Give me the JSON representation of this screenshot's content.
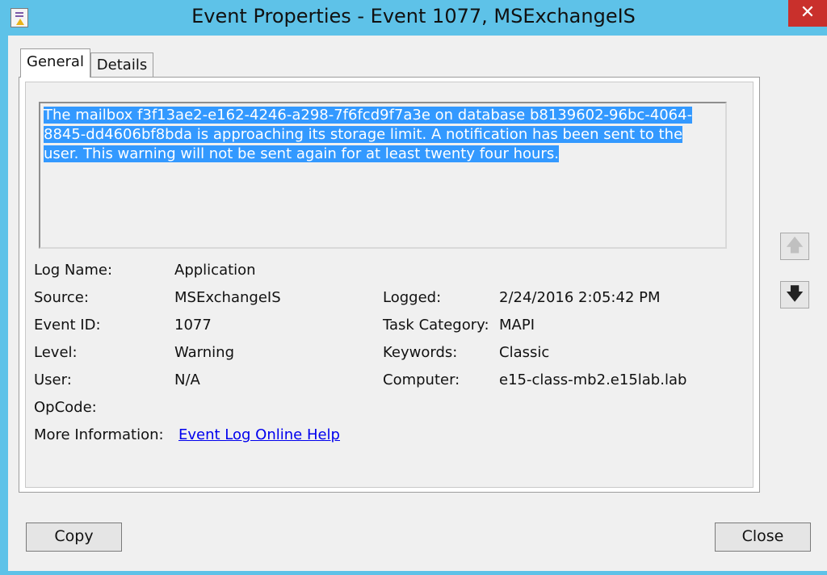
{
  "window": {
    "title": "Event Properties - Event 1077, MSExchangeIS",
    "close_glyph": "✕"
  },
  "tabs": [
    {
      "label": "General"
    },
    {
      "label": "Details"
    }
  ],
  "description": "The mailbox f3f13ae2-e162-4246-a298-7f6fcd9f7a3e on database b8139602-96bc-4064-8845-dd4606bf8bda is approaching its storage limit. A notification has been sent to the user. This warning will not be sent again for at least twenty four hours.",
  "fields": {
    "log_name": {
      "label": "Log Name:",
      "value": "Application"
    },
    "source": {
      "label": "Source:",
      "value": "MSExchangeIS"
    },
    "event_id": {
      "label": "Event ID:",
      "value": "1077"
    },
    "level": {
      "label": "Level:",
      "value": "Warning"
    },
    "user": {
      "label": "User:",
      "value": "N/A"
    },
    "opcode": {
      "label": "OpCode:",
      "value": ""
    },
    "more_info": {
      "label": "More Information:",
      "value": "Event Log Online Help"
    },
    "logged": {
      "label": "Logged:",
      "value": "2/24/2016 2:05:42 PM"
    },
    "task_category": {
      "label": "Task Category:",
      "value": "MAPI"
    },
    "keywords": {
      "label": "Keywords:",
      "value": "Classic"
    },
    "computer": {
      "label": "Computer:",
      "value": "e15-class-mb2.e15lab.lab"
    }
  },
  "nav": {
    "up_glyph": "🡅",
    "down_glyph": "🡇"
  },
  "buttons": {
    "copy": "Copy",
    "close": "Close"
  },
  "colors": {
    "title_bar": "#5ec2e8",
    "selection": "#3399ff",
    "close_button": "#c9302c",
    "link": "#0000ee"
  }
}
